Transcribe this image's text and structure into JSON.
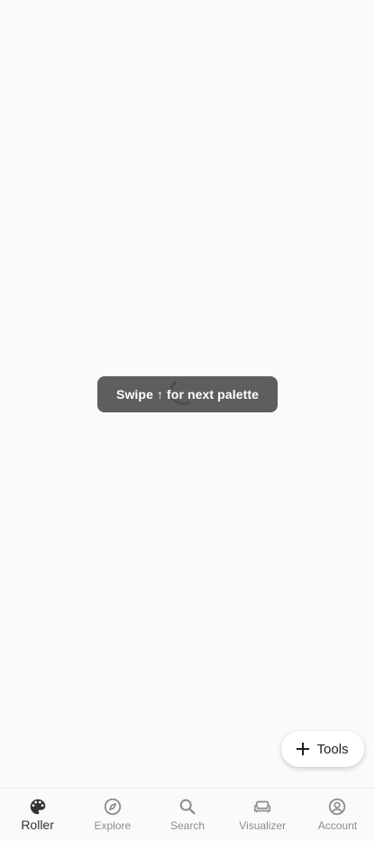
{
  "toast": {
    "text": "Swipe ↑ for next palette"
  },
  "fab": {
    "label": "Tools",
    "icon": "plus-icon"
  },
  "nav": {
    "active": "Roller",
    "items": [
      {
        "label": "Roller",
        "icon": "palette-icon"
      },
      {
        "label": "Explore",
        "icon": "compass-icon"
      },
      {
        "label": "Search",
        "icon": "search-icon"
      },
      {
        "label": "Visualizer",
        "icon": "sofa-icon"
      },
      {
        "label": "Account",
        "icon": "account-circle-icon"
      }
    ]
  },
  "colors": {
    "background": "#fafafa",
    "toast_bg": "#505050",
    "active_icon": "#333333",
    "inactive_icon": "#8c8c8c"
  }
}
